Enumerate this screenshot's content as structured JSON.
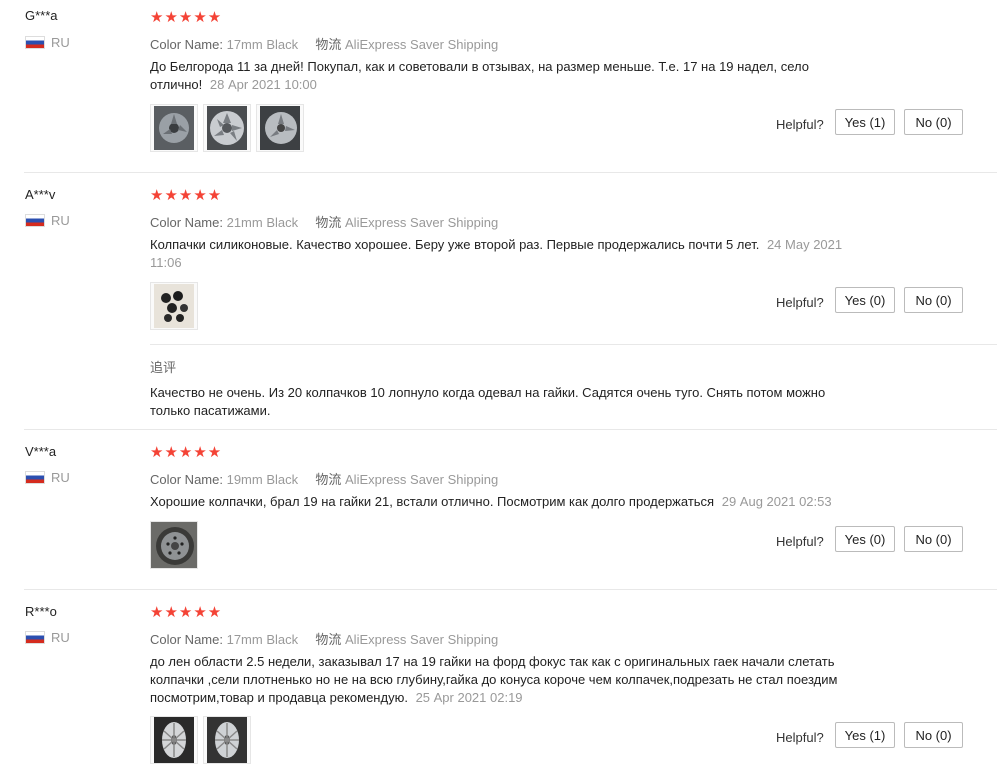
{
  "helpful_label": "Helpful?",
  "color_key": "Color Name:",
  "shipping_key": "物流",
  "accent_color": "#f44336",
  "reviews": [
    {
      "user": "G***a",
      "country": "RU",
      "stars": "★★★★★",
      "color": "17mm Black",
      "shipping": "AliExpress Saver Shipping",
      "text": "До Белгорода 11 за дней! Покупал, как и советовали в отзывах, на размер меньше. Т.е. 17 на 19 надел, село отлично!",
      "date": "28 Apr 2021 10:00",
      "yes": "Yes (1)",
      "no": "No (0)"
    },
    {
      "user": "A***v",
      "country": "RU",
      "stars": "★★★★★",
      "color": "21mm Black",
      "shipping": "AliExpress Saver Shipping",
      "text": "Колпачки силиконовые. Качество хорошее. Беру уже второй раз. Первые продержались почти 5 лет.",
      "date": "24 May 2021 11:06",
      "yes": "Yes (0)",
      "no": "No (0)",
      "additional_label": "追评",
      "additional_text": "Качество не очень. Из 20 колпачков 10 лопнуло когда одевал на гайки. Садятся очень туго. Снять потом можно только пасатижами."
    },
    {
      "user": "V***a",
      "country": "RU",
      "stars": "★★★★★",
      "color": "19mm Black",
      "shipping": "AliExpress Saver Shipping",
      "text": "Хорошие колпачки, брал 19 на гайки 21, встали отлично. Посмотрим как долго продержаться",
      "date": "29 Aug 2021 02:53",
      "yes": "Yes (0)",
      "no": "No (0)"
    },
    {
      "user": "R***o",
      "country": "RU",
      "stars": "★★★★★",
      "color": "17mm Black",
      "shipping": "AliExpress Saver Shipping",
      "text": "до лен области 2.5 недели, заказывал 17 на 19 гайки на форд фокус так как с оригинальных гаек начали слетать колпачки ,сели плотненько но не на всю глубину,гайка до конуса короче чем колпачек,подрезать не стал поездим посмотрим,товар и продавца рекомендую.",
      "date": "25 Apr 2021 02:19",
      "yes": "Yes (1)",
      "no": "No (0)"
    }
  ]
}
